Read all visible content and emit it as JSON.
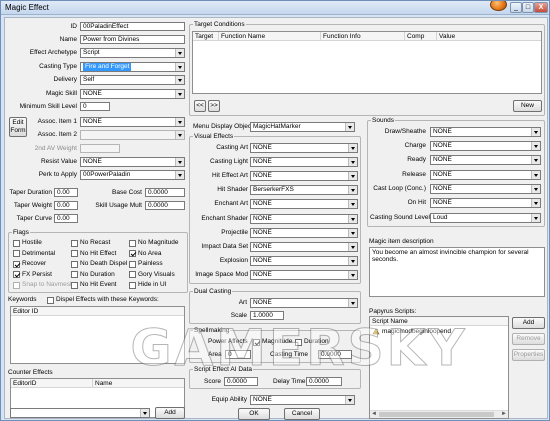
{
  "window": {
    "title": "Magic Effect",
    "buttons": {
      "minimize": "_",
      "maximize": "□",
      "close": "X"
    }
  },
  "left": {
    "id": {
      "label": "ID",
      "value": "00PaladinEffect"
    },
    "name": {
      "label": "Name",
      "value": "Power from Divines"
    },
    "archetype": {
      "label": "Effect Archetype",
      "value": "Script"
    },
    "casting_type": {
      "label": "Casting Type",
      "value": "Fire and Forget"
    },
    "delivery": {
      "label": "Delivery",
      "value": "Self"
    },
    "magic_skill": {
      "label": "Magic Skill",
      "value": "NONE"
    },
    "min_skill": {
      "label": "Minimum Skill Level",
      "value": "0"
    },
    "edit_form": {
      "line1": "Edit",
      "line2": "Form"
    },
    "assoc1": {
      "label": "Assoc. Item 1",
      "value": "NONE"
    },
    "assoc2": {
      "label": "Assoc. Item 2",
      "value": ""
    },
    "second_av": {
      "label": "2nd AV Weight",
      "value": ""
    },
    "resist": {
      "label": "Resist Value",
      "value": "NONE"
    },
    "perk": {
      "label": "Perk to Apply",
      "value": "00PowerPaladin"
    },
    "taper_duration": {
      "label": "Taper Duration",
      "value": "0.00"
    },
    "base_cost": {
      "label": "Base Cost",
      "value": "0.0000"
    },
    "taper_weight": {
      "label": "Taper Weight",
      "value": "0.00"
    },
    "skill_usage": {
      "label": "Skill Usage Mult",
      "value": "0.0000"
    },
    "taper_curve": {
      "label": "Taper Curve",
      "value": "0.00"
    }
  },
  "flags": {
    "title": "Flags",
    "items": [
      {
        "label": "Hostile",
        "checked": false,
        "disabled": false
      },
      {
        "label": "No Recast",
        "checked": false,
        "disabled": false
      },
      {
        "label": "No Magnitude",
        "checked": false,
        "disabled": false
      },
      {
        "label": "Detrimental",
        "checked": false,
        "disabled": false
      },
      {
        "label": "No Hit Effect",
        "checked": false,
        "disabled": false
      },
      {
        "label": "No Area",
        "checked": true,
        "disabled": false
      },
      {
        "label": "Recover",
        "checked": true,
        "disabled": false
      },
      {
        "label": "No Death Dispel",
        "checked": false,
        "disabled": false
      },
      {
        "label": "Painless",
        "checked": false,
        "disabled": false
      },
      {
        "label": "FX Persist",
        "checked": true,
        "disabled": false
      },
      {
        "label": "No Duration",
        "checked": false,
        "disabled": false
      },
      {
        "label": "Gory Visuals",
        "checked": false,
        "disabled": false
      },
      {
        "label": "Snap to Navmesh",
        "checked": false,
        "disabled": true
      },
      {
        "label": "No Hit Event",
        "checked": false,
        "disabled": false
      },
      {
        "label": "Hide in UI",
        "checked": false,
        "disabled": false
      }
    ]
  },
  "keywords": {
    "title": "Keywords",
    "dispel_label": "Dispel Effects with these Keywords:",
    "column": "Editor ID"
  },
  "counter": {
    "title": "Counter Effects",
    "columns": [
      "EditorID",
      "Name"
    ],
    "add": "Add"
  },
  "target": {
    "title": "Target Conditions",
    "columns": [
      "Target",
      "Function Name",
      "Function Info",
      "Comp",
      "Value"
    ],
    "prev": "<<",
    "next": ">>",
    "new": "New"
  },
  "menu_display": {
    "label": "Menu Display Object",
    "value": "MagicHatMarker"
  },
  "visual": {
    "title": "Visual Effects",
    "rows": [
      {
        "label": "Casting Art",
        "value": "NONE"
      },
      {
        "label": "Casting Light",
        "value": "NONE"
      },
      {
        "label": "Hit Effect Art",
        "value": "NONE"
      },
      {
        "label": "Hit Shader",
        "value": "BerserkerFXS"
      },
      {
        "label": "Enchant Art",
        "value": "NONE"
      },
      {
        "label": "Enchant Shader",
        "value": "NONE"
      },
      {
        "label": "Projectile",
        "value": "NONE"
      },
      {
        "label": "Impact Data Set",
        "value": "NONE"
      },
      {
        "label": "Explosion",
        "value": "NONE"
      },
      {
        "label": "Image Space Mod",
        "value": "NONE"
      }
    ]
  },
  "dual": {
    "title": "Dual Casting",
    "art_label": "Art",
    "art": "NONE",
    "scale_label": "Scale",
    "scale": "1.0000"
  },
  "spellmaking": {
    "title": "Spellmaking",
    "power_affects": "Power Affects",
    "magnitude": "Magnitude",
    "magnitude_checked": true,
    "duration": "Duration",
    "duration_checked": false,
    "area_label": "Area",
    "area": "0",
    "casting_time_label": "Casting Time",
    "casting_time": "0.0000"
  },
  "script_ai": {
    "title": "Script Effect AI Data",
    "score_label": "Score",
    "score": "0.0000",
    "delay_label": "Delay Time",
    "delay": "0.0000"
  },
  "equip": {
    "label": "Equip Ability",
    "value": "NONE"
  },
  "ok": "OK",
  "cancel": "Cancel",
  "sounds": {
    "title": "Sounds",
    "rows": [
      {
        "label": "Draw/Sheathe",
        "value": "NONE"
      },
      {
        "label": "Charge",
        "value": "NONE"
      },
      {
        "label": "Ready",
        "value": "NONE"
      },
      {
        "label": "Release",
        "value": "NONE"
      },
      {
        "label": "Cast Loop (Conc.)",
        "value": "NONE"
      },
      {
        "label": "On Hit",
        "value": "NONE"
      }
    ],
    "level_label": "Casting Sound Level",
    "level": "Loud"
  },
  "desc": {
    "label": "Magic item description",
    "text": "You become an almost invincible champion for several seconds."
  },
  "papyrus": {
    "title": "Papyrus Scripts:",
    "column": "Script Name",
    "script": "magicmodbeginloopend",
    "add": "Add",
    "remove": "Remove",
    "properties": "Properties"
  },
  "watermark": "GAMERSKY",
  "colors": {
    "selection": "#3399ff",
    "window_frame": "#d6e3f2",
    "dialog": "#f0f0f0"
  }
}
